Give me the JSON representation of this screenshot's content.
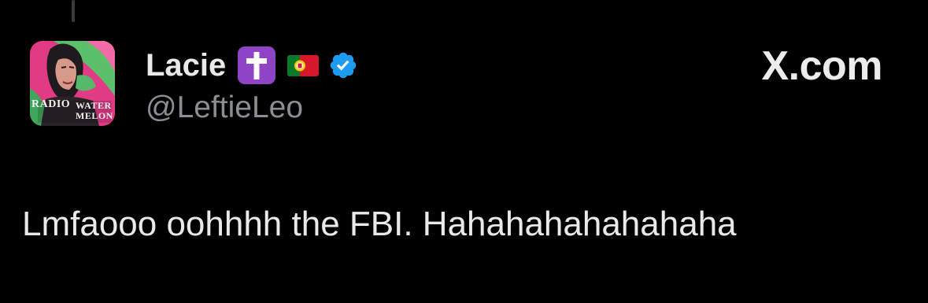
{
  "tweet": {
    "author": {
      "display_name": "Lacie",
      "handle": "@LeftieLeo",
      "avatar_caption_left": "RADIO",
      "avatar_caption_right_1": "WATER",
      "avatar_caption_right_2": "MELON",
      "name_emojis": [
        "latin-cross-emoji",
        "portugal-flag-emoji"
      ],
      "verified": true
    },
    "text": "Lmfaooo oohhhh the FBI. Hahahahahahahaha"
  },
  "watermark": {
    "site": "X.com"
  },
  "colors": {
    "background": "#000000",
    "primary_text": "#e7e9ea",
    "secondary_text": "#8b8f94",
    "verified_blue": "#1d9bf0",
    "cross_emoji_purple": "#8e44c4"
  }
}
